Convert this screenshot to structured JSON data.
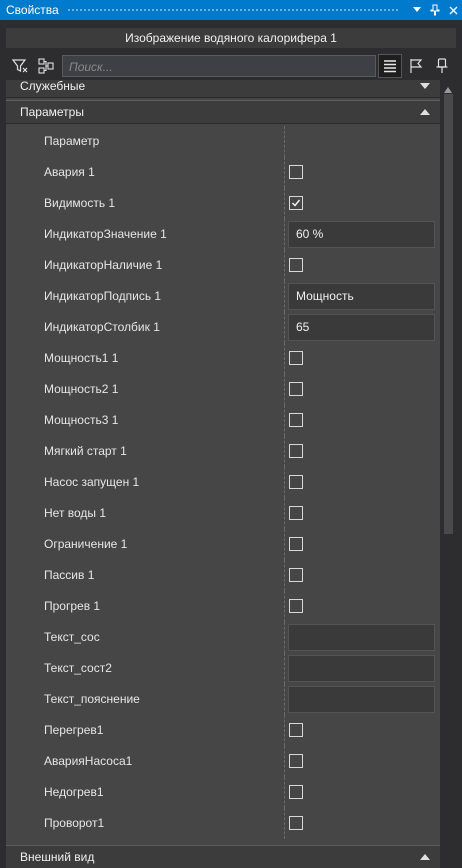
{
  "window": {
    "title": "Свойства"
  },
  "header": {
    "object_name": "Изображение водяного калорифера 1"
  },
  "toolbar": {
    "search_placeholder": "Поиск..."
  },
  "categories": {
    "service": {
      "label": "Служебные"
    },
    "params": {
      "label": "Параметры"
    },
    "appearance": {
      "label": "Внешний вид"
    }
  },
  "properties": [
    {
      "name": "Параметр",
      "type": "none"
    },
    {
      "name": "Авария 1",
      "type": "check",
      "checked": false
    },
    {
      "name": "Видимость 1",
      "type": "check",
      "checked": true
    },
    {
      "name": "ИндикаторЗначение 1",
      "type": "text",
      "value": "60 %"
    },
    {
      "name": "ИндикаторНаличие 1",
      "type": "check",
      "checked": false
    },
    {
      "name": "ИндикаторПодпись 1",
      "type": "text",
      "value": "Мощность"
    },
    {
      "name": "ИндикаторСтолбик 1",
      "type": "text",
      "value": "65"
    },
    {
      "name": "Мощность1 1",
      "type": "check",
      "checked": false
    },
    {
      "name": "Мощность2 1",
      "type": "check",
      "checked": false
    },
    {
      "name": "Мощность3 1",
      "type": "check",
      "checked": false
    },
    {
      "name": "Мягкий старт 1",
      "type": "check",
      "checked": false
    },
    {
      "name": "Насос запущен 1",
      "type": "check",
      "checked": false
    },
    {
      "name": "Нет воды 1",
      "type": "check",
      "checked": false
    },
    {
      "name": "Ограничение 1",
      "type": "check",
      "checked": false
    },
    {
      "name": "Пассив 1",
      "type": "check",
      "checked": false
    },
    {
      "name": "Прогрев 1",
      "type": "check",
      "checked": false
    },
    {
      "name": "Текст_сос",
      "type": "text",
      "value": ""
    },
    {
      "name": "Текст_сост2",
      "type": "text",
      "value": ""
    },
    {
      "name": "Текст_пояснение",
      "type": "text",
      "value": ""
    },
    {
      "name": "Перегрев1",
      "type": "check",
      "checked": false
    },
    {
      "name": "АварияНасоса1",
      "type": "check",
      "checked": false
    },
    {
      "name": "Недогрев1",
      "type": "check",
      "checked": false
    },
    {
      "name": "Проворот1",
      "type": "check",
      "checked": false
    }
  ],
  "colors": {
    "accent": "#007acc",
    "panel": "#464646",
    "background": "#2d2d30"
  }
}
